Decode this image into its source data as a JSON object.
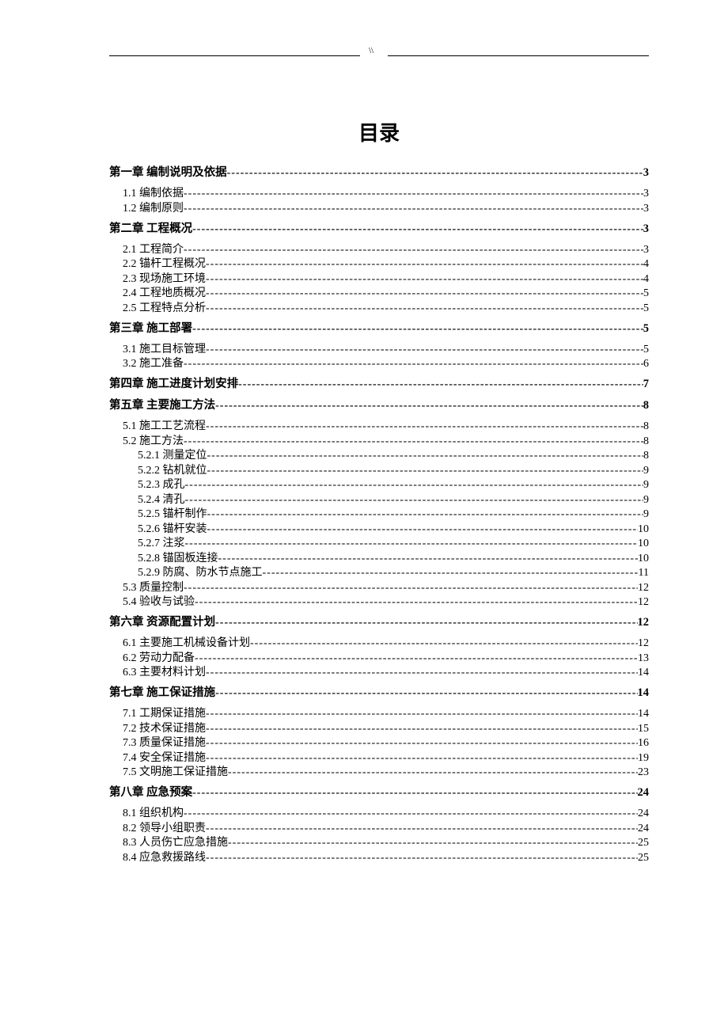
{
  "header_mark": "\\\\",
  "title": "目录",
  "toc": [
    {
      "level": 1,
      "label": "第一章   编制说明及依据",
      "page": "3"
    },
    {
      "level": 2,
      "label": "1.1 编制依据",
      "page": "3",
      "block_start": true
    },
    {
      "level": 2,
      "label": "1.2 编制原则",
      "page": "3"
    },
    {
      "level": 1,
      "label": "第二章   工程概况",
      "page": "3"
    },
    {
      "level": 2,
      "label": "2.1 工程简介",
      "page": "3",
      "block_start": true
    },
    {
      "level": 2,
      "label": "2.2 锚杆工程概况",
      "page": "4"
    },
    {
      "level": 2,
      "label": "2.3 现场施工环境",
      "page": "4"
    },
    {
      "level": 2,
      "label": "2.4 工程地质概况",
      "page": "5"
    },
    {
      "level": 2,
      "label": "2.5 工程特点分析",
      "page": "5"
    },
    {
      "level": 1,
      "label": "第三章   施工部署",
      "page": "5"
    },
    {
      "level": 2,
      "label": "3.1 施工目标管理",
      "page": "5",
      "block_start": true
    },
    {
      "level": 2,
      "label": "3.2 施工准备",
      "page": "6"
    },
    {
      "level": 1,
      "label": "第四章   施工进度计划安排",
      "page": "7"
    },
    {
      "level": 1,
      "label": "第五章  主要施工方法",
      "page": "8"
    },
    {
      "level": 2,
      "label": "5.1 施工工艺流程",
      "page": "8",
      "block_start": true
    },
    {
      "level": 2,
      "label": "5.2 施工方法",
      "page": "8"
    },
    {
      "level": 3,
      "label": "5.2.1 测量定位",
      "page": "8"
    },
    {
      "level": 3,
      "label": "5.2.2 钻机就位",
      "page": "9"
    },
    {
      "level": 3,
      "label": "5.2.3 成孔",
      "page": "9"
    },
    {
      "level": 3,
      "label": "5.2.4 清孔",
      "page": "9"
    },
    {
      "level": 3,
      "label": "5.2.5 锚杆制作",
      "page": "9"
    },
    {
      "level": 3,
      "label": "5.2.6 锚杆安装",
      "page": "10"
    },
    {
      "level": 3,
      "label": "5.2.7 注浆",
      "page": "10"
    },
    {
      "level": 3,
      "label": "5.2.8 锚固板连接",
      "page": "10"
    },
    {
      "level": 3,
      "label": "5.2.9 防腐、防水节点施工",
      "page": "11"
    },
    {
      "level": 2,
      "label": "5.3 质量控制",
      "page": "12"
    },
    {
      "level": 2,
      "label": "5.4 验收与试验",
      "page": "12"
    },
    {
      "level": 1,
      "label": "第六章   资源配置计划",
      "page": "12"
    },
    {
      "level": 2,
      "label": "6.1 主要施工机械设备计划",
      "page": "12",
      "block_start": true
    },
    {
      "level": 2,
      "label": "6.2 劳动力配备",
      "page": "13"
    },
    {
      "level": 2,
      "label": "6.3 主要材料计划",
      "page": "14"
    },
    {
      "level": 1,
      "label": "第七章   施工保证措施",
      "page": "14"
    },
    {
      "level": 2,
      "label": "7.1 工期保证措施",
      "page": "14",
      "block_start": true
    },
    {
      "level": 2,
      "label": "7.2 技术保证措施",
      "page": "15"
    },
    {
      "level": 2,
      "label": "7.3 质量保证措施",
      "page": "16"
    },
    {
      "level": 2,
      "label": "7.4 安全保证措施",
      "page": "19"
    },
    {
      "level": 2,
      "label": "7.5 文明施工保证措施",
      "page": "23"
    },
    {
      "level": 1,
      "label": "第八章  应急预案",
      "page": "24"
    },
    {
      "level": 2,
      "label": "8.1 组织机构",
      "page": "24",
      "block_start": true
    },
    {
      "level": 2,
      "label": "8.2 领导小组职责",
      "page": "24"
    },
    {
      "level": 2,
      "label": "8.3 人员伤亡应急措施",
      "page": "25"
    },
    {
      "level": 2,
      "label": "8.4 应急救援路线",
      "page": "25"
    }
  ]
}
